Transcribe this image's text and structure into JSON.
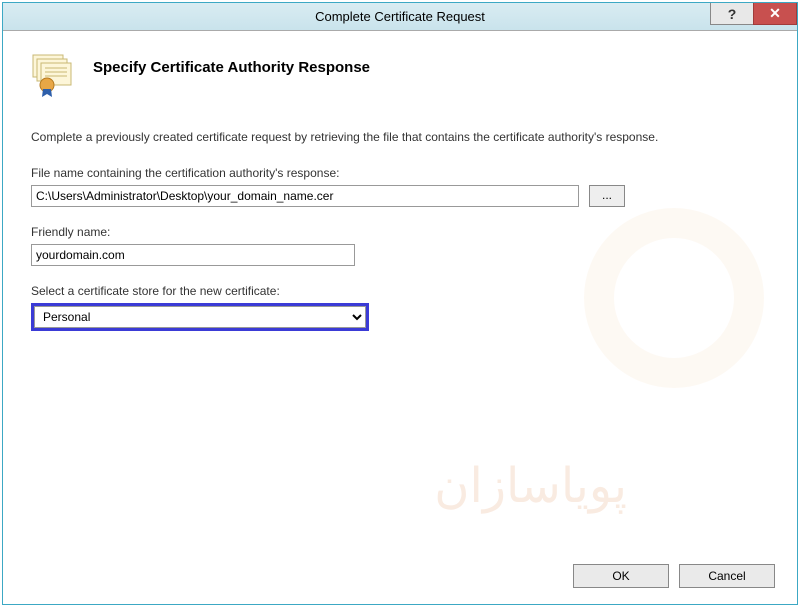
{
  "window": {
    "title": "Complete Certificate Request"
  },
  "header": {
    "heading": "Specify Certificate Authority Response"
  },
  "form": {
    "description": "Complete a previously created certificate request by retrieving the file that contains the certificate authority's response.",
    "file_label": "File name containing the certification authority's response:",
    "file_value": "C:\\Users\\Administrator\\Desktop\\your_domain_name.cer",
    "browse_label": "...",
    "friendly_label": "Friendly name:",
    "friendly_value": "yourdomain.com",
    "store_label": "Select a certificate store for the new certificate:",
    "store_value": "Personal"
  },
  "buttons": {
    "ok": "OK",
    "cancel": "Cancel"
  },
  "watermark_text": "پویاسازان"
}
